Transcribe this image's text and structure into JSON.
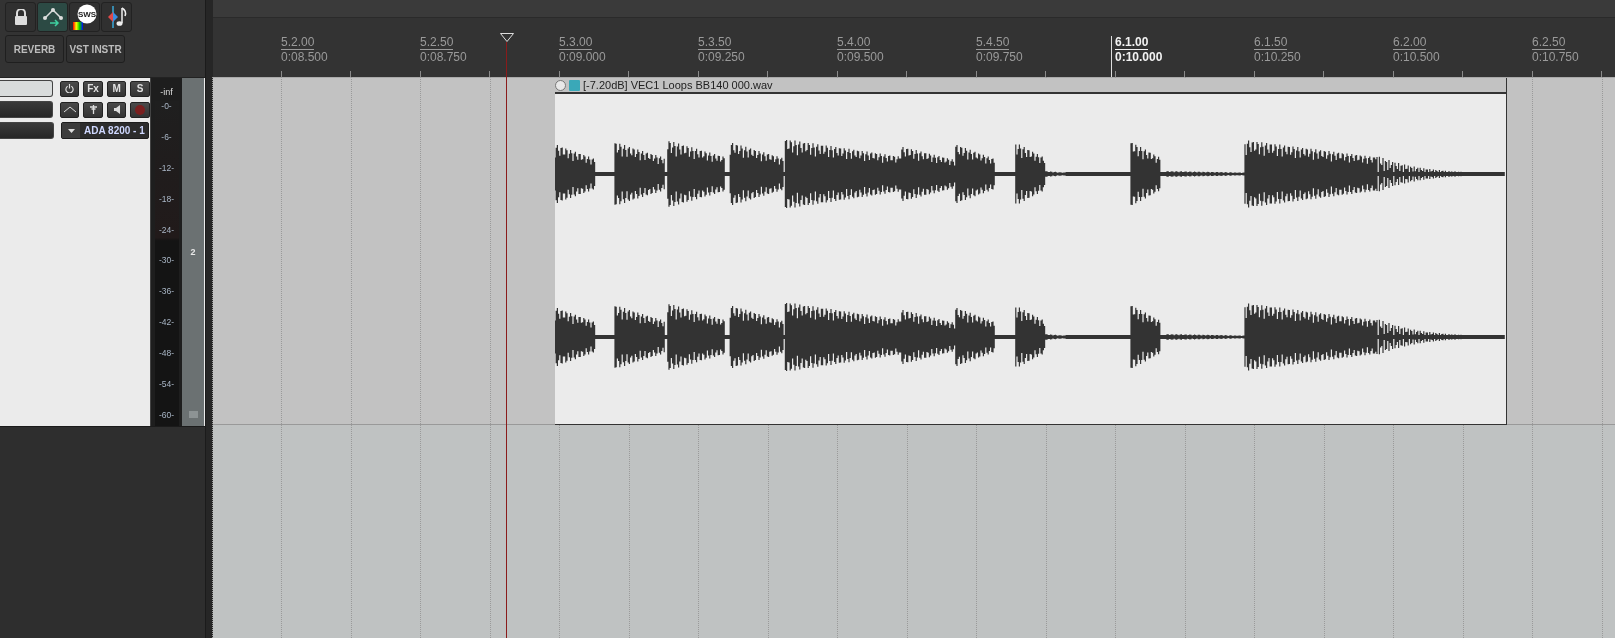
{
  "toolbar": {
    "icons": [
      {
        "kind": "lock",
        "selected": false
      },
      {
        "kind": "routing",
        "selected": true
      },
      {
        "kind": "sws",
        "label": "SWS",
        "selected": false
      },
      {
        "kind": "midi",
        "selected": false
      }
    ],
    "buttons": [
      "REVERB",
      "VST INSTR"
    ]
  },
  "track": {
    "number": "2",
    "buttons": [
      "Fx",
      "M",
      "S"
    ],
    "record_armed": false,
    "input": "ADA 8200 - 1",
    "meter_peak": "-inf",
    "meter_ticks": [
      "-0-",
      "-6-",
      "-12-",
      "-18-",
      "-24-",
      "-30-",
      "-36-",
      "-42-",
      "-48-",
      "-54-",
      "-60-"
    ]
  },
  "ruler": {
    "marks": [
      {
        "bar": "5.2.00",
        "time": "0:08.500",
        "current": false
      },
      {
        "bar": "5.2.50",
        "time": "0:08.750",
        "current": false
      },
      {
        "bar": "5.3.00",
        "time": "0:09.000",
        "current": false
      },
      {
        "bar": "5.3.50",
        "time": "0:09.250",
        "current": false
      },
      {
        "bar": "5.4.00",
        "time": "0:09.500",
        "current": false
      },
      {
        "bar": "5.4.50",
        "time": "0:09.750",
        "current": false
      },
      {
        "bar": "6.1.00",
        "time": "0:10.000",
        "current": true
      },
      {
        "bar": "6.1.50",
        "time": "0:10.250",
        "current": false
      },
      {
        "bar": "6.2.00",
        "time": "0:10.500",
        "current": false
      },
      {
        "bar": "6.2.50",
        "time": "0:10.750",
        "current": false
      }
    ]
  },
  "item": {
    "title": "[-7.20dB] VEC1 Loops BB140 000.wav"
  }
}
